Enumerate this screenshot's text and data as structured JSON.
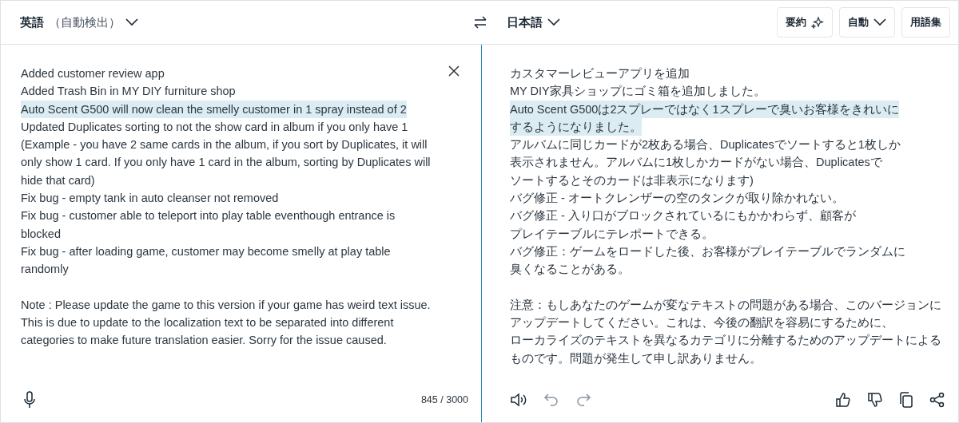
{
  "source_language": {
    "name": "英語",
    "detected": "（自動検出）"
  },
  "target_language": {
    "name": "日本語"
  },
  "toolbar": {
    "summarize": "要約",
    "tone": "自動",
    "glossary": "用語集"
  },
  "source_paragraphs": [
    {
      "lines": [
        {
          "text": "Added customer review app",
          "highlighted": false
        },
        {
          "text": "Added Trash Bin in MY DIY furniture shop",
          "highlighted": false
        },
        {
          "text": "Auto Scent G500 will now clean the smelly customer in 1 spray instead of 2",
          "highlighted": true
        },
        {
          "text": "Updated Duplicates sorting to not the show card in album if you only have 1",
          "highlighted": false
        },
        {
          "text": "(Example - you have 2 same cards in the album, if you sort by Duplicates, it will",
          "highlighted": false
        },
        {
          "text": "only show 1 card. If you only have 1 card in the album, sorting by Duplicates will",
          "highlighted": false
        },
        {
          "text": "hide that card)",
          "highlighted": false
        },
        {
          "text": "Fix bug - empty tank in auto cleanser not removed",
          "highlighted": false
        },
        {
          "text": "Fix bug - customer able to teleport into play table eventhough entrance is",
          "highlighted": false
        },
        {
          "text": "blocked",
          "highlighted": false
        },
        {
          "text": "Fix bug - after loading game, customer may become smelly at play table",
          "highlighted": false
        },
        {
          "text": "randomly",
          "highlighted": false
        }
      ]
    },
    {
      "lines": [
        {
          "text": "Note : Please update the game to this version if your game has weird text issue.",
          "highlighted": false
        },
        {
          "text": "This is due to update to the localization text to be separated into different",
          "highlighted": false
        },
        {
          "text": "categories to make future translation easier. Sorry for the issue caused.",
          "highlighted": false
        }
      ]
    }
  ],
  "character_count": "845 / 3000",
  "target_paragraphs": [
    {
      "lines": [
        {
          "text": "カスタマーレビューアプリを追加",
          "highlighted": false
        },
        {
          "text": "MY DIY家具ショップにゴミ箱を追加しました。",
          "highlighted": false
        },
        {
          "text": "Auto Scent G500は2スプレーではなく1スプレーで臭いお客様をきれいに",
          "highlighted": true
        },
        {
          "text": "するようになりました。",
          "highlighted": true
        },
        {
          "text": "アルバムに同じカードが2枚ある場合、Duplicatesでソートすると1枚しか",
          "highlighted": false
        },
        {
          "text": "表示されません。アルバムに1枚しかカードがない場合、Duplicatesで",
          "highlighted": false
        },
        {
          "text": "ソートするとそのカードは非表示になります)",
          "highlighted": false
        },
        {
          "text": "バグ修正 - オートクレンザーの空のタンクが取り除かれない。",
          "highlighted": false
        },
        {
          "text": "バグ修正 - 入り口がブロックされているにもかかわらず、顧客が",
          "highlighted": false
        },
        {
          "text": "プレイテーブルにテレポートできる。",
          "highlighted": false
        },
        {
          "text": "バグ修正：ゲームをロードした後、お客様がプレイテーブルでランダムに",
          "highlighted": false
        },
        {
          "text": "臭くなることがある。",
          "highlighted": false
        }
      ]
    },
    {
      "lines": [
        {
          "text": "注意：もしあなたのゲームが変なテキストの問題がある場合、このバージョンに",
          "highlighted": false
        },
        {
          "text": "アップデートしてください。これは、今後の翻訳を容易にするために、",
          "highlighted": false
        },
        {
          "text": "ローカライズのテキストを異なるカテゴリに分離するためのアップデートによる",
          "highlighted": false
        },
        {
          "text": "ものです。問題が発生して申し訳ありません。",
          "highlighted": false
        }
      ]
    }
  ]
}
